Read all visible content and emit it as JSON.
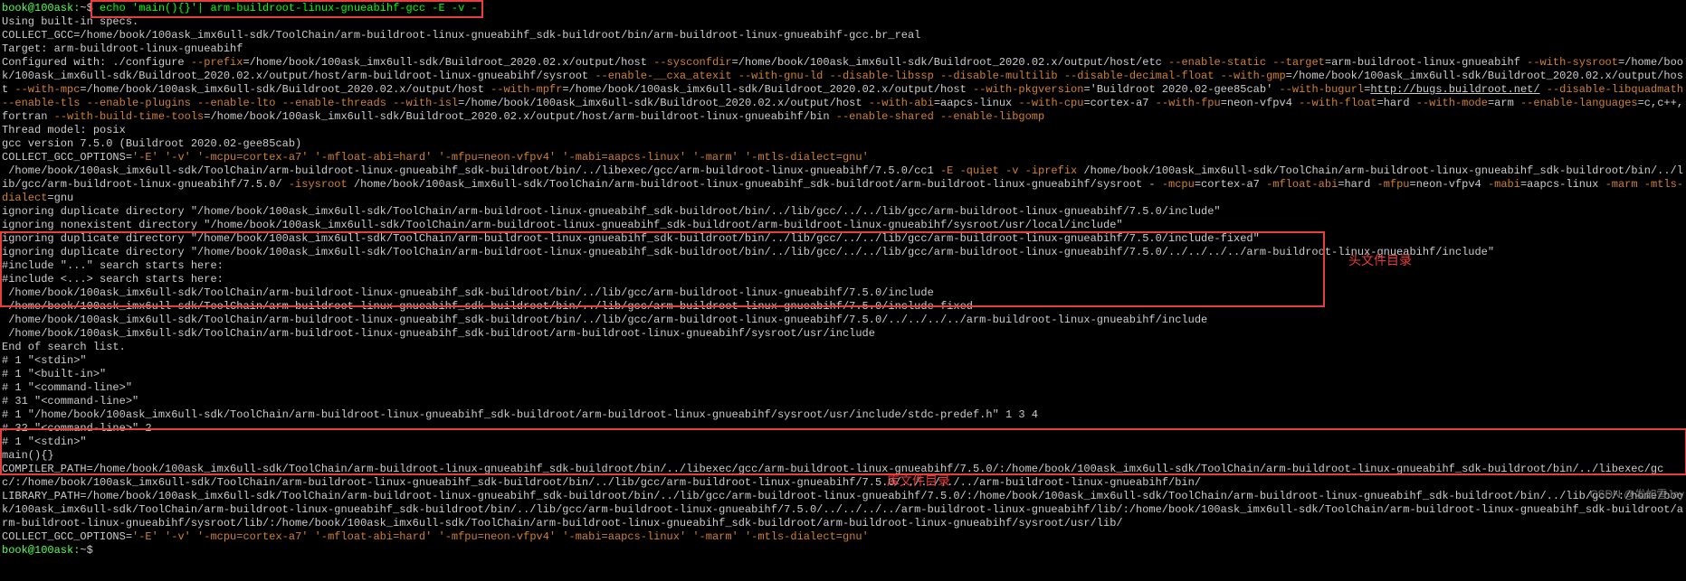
{
  "prompt1_user": "book@100ask:",
  "prompt1_path": "~$ ",
  "command": "echo 'main(){}'| arm-buildroot-linux-gnueabihf-gcc -E -v -",
  "line_using": "Using built-in specs.",
  "collect_gcc_pre": "COLLECT_GCC=",
  "collect_gcc_val": "/home/book/100ask_imx6ull-sdk/ToolChain/arm-buildroot-linux-gnueabihf_sdk-buildroot/bin/arm-buildroot-linux-gnueabihf-gcc.br_real",
  "target_pre": "Target: ",
  "target_val": "arm-buildroot-linux-gnueabihf",
  "cfg_pre": "Configured with: ./configure ",
  "cfg_prefix_k": "--prefix",
  "cfg_prefix_v": "=/home/book/100ask_imx6ull-sdk/Buildroot_2020.02.x/output/host ",
  "cfg_sysconf_k": "--sysconfdir",
  "cfg_sysconf_v": "=/home/book/100ask_imx6ull-sdk/Buildroot_2020.02.x/output/host/etc ",
  "cfg_enstatic": "--enable-static ",
  "cfg_target_k": "--target",
  "cfg_target_v": "=arm-buildroot-linux-gnueabihf ",
  "cfg_sysroot_k": "--with-sysroot",
  "cfg_sysroot_v": "=/home/book/100ask_imx6ull-sdk/Buildroot_2020.02.x/output/host/arm-buildroot-linux-gnueabihf/sysroot ",
  "cfg_cxa": "--enable-__cxa_atexit ",
  "cfg_gnuld": "--with-gnu-ld ",
  "cfg_libssp": "--disable-libssp ",
  "cfg_multi": "--disable-multilib ",
  "cfg_decfloat": "--disable-decimal-float ",
  "cfg_gmp_k": "--with-gmp",
  "cfg_gmp_v": "=/home/book/100ask_imx6ull-sdk/Buildroot_2020.02.x/output/host ",
  "cfg_mpc_k": "--with-mpc",
  "cfg_mpc_v": "=/home/book/100ask_imx6ull-sdk/Buildroot_2020.02.x/output/host ",
  "cfg_mpfr_k": "--with-mpfr",
  "cfg_mpfr_v": "=/home/book/100ask_imx6ull-sdk/Buildroot_2020.02.x/output/host ",
  "cfg_pkgver_k": "--with-pkgversion",
  "cfg_pkgver_v": "='Buildroot 2020.02-gee85cab' ",
  "cfg_bugurl_k": "--with-bugurl",
  "cfg_bugurl_eq": "=",
  "cfg_bugurl_v": "http://bugs.buildroot.net/",
  "cfg_libquad": " --disable-libquadmath ",
  "cfg_tls": "--enable-tls ",
  "cfg_plugins": "--enable-plugins ",
  "cfg_lto": "--enable-lto ",
  "cfg_threads": "--enable-threads ",
  "cfg_isl_k": "--with-isl",
  "cfg_isl_v": "=/home/book/100ask_imx6ull-sdk/Buildroot_2020.02.x/output/host ",
  "cfg_abi_k": "--with-abi",
  "cfg_abi_v": "=aapcs-linux ",
  "cfg_cpu_k": "--with-cpu",
  "cfg_cpu_v": "=cortex-a7 ",
  "cfg_fpu_k": "--with-fpu",
  "cfg_fpu_v": "=neon-vfpv4 ",
  "cfg_float_k": "--with-float",
  "cfg_float_v": "=hard ",
  "cfg_mode_k": "--with-mode",
  "cfg_mode_v": "=arm ",
  "cfg_lang_k": "--enable-languages",
  "cfg_lang_v": "=c,c++,fortran ",
  "cfg_btt_k": "--with-build-time-tools",
  "cfg_btt_v": "=/home/book/100ask_imx6ull-sdk/Buildroot_2020.02.x/output/host/arm-buildroot-linux-gnueabihf/bin ",
  "cfg_shared": "--enable-shared ",
  "cfg_gomp": "--enable-libgomp",
  "thread_model": "Thread model: posix",
  "gcc_version": "gcc version 7.5.0 (Buildroot 2020.02-gee85cab)",
  "opts1_pre": "COLLECT_GCC_OPTIONS=",
  "opts1_val": "'-E' '-v' '-mcpu=cortex-a7' '-mfloat-abi=hard' '-mfpu=neon-vfpv4' '-mabi=aapcs-linux' '-marm' '-mtls-dialect=gnu'",
  "cc1_1": " /home/book/100ask_imx6ull-sdk/ToolChain/arm-buildroot-linux-gnueabihf_sdk-buildroot/bin/../libexec/gcc/arm-buildroot-linux-gnueabihf/7.5.0/cc1 ",
  "cc1_E": "-E ",
  "cc1_q": "-quiet ",
  "cc1_v": "-v ",
  "cc1_ip": "-iprefix",
  "cc1_ip_v": " /home/book/100ask_imx6ull-sdk/ToolChain/arm-buildroot-linux-gnueabihf_sdk-buildroot/bin/../lib/gcc/arm-buildroot-linux-gnueabihf/7.5.0/ ",
  "cc1_isys": "-isysroot",
  "cc1_isys_v": " /home/book/100ask_imx6ull-sdk/ToolChain/arm-buildroot-linux-gnueabihf_sdk-buildroot/arm-buildroot-linux-gnueabihf/sysroot - ",
  "cc1_mcpu": "-mcpu",
  "cc1_mcpu_v": "=cortex-a7 ",
  "cc1_mfabi": "-mfloat-abi",
  "cc1_mfabi_v": "=hard ",
  "cc1_mfpu": "-mfpu",
  "cc1_mfpu_v": "=neon-vfpv4 ",
  "cc1_mabi": "-mabi",
  "cc1_mabi_v": "=aapcs-linux ",
  "cc1_marm": "-marm ",
  "cc1_mtls": "-mtls-dialect",
  "cc1_mtls_v": "=gnu",
  "ign1": "ignoring duplicate directory \"/home/book/100ask_imx6ull-sdk/ToolChain/arm-buildroot-linux-gnueabihf_sdk-buildroot/bin/../lib/gcc/../../lib/gcc/arm-buildroot-linux-gnueabihf/7.5.0/include\"",
  "ign2": "ignoring nonexistent directory \"/home/book/100ask_imx6ull-sdk/ToolChain/arm-buildroot-linux-gnueabihf_sdk-buildroot/arm-buildroot-linux-gnueabihf/sysroot/usr/local/include\"",
  "ign3": "ignoring duplicate directory \"/home/book/100ask_imx6ull-sdk/ToolChain/arm-buildroot-linux-gnueabihf_sdk-buildroot/bin/../lib/gcc/../../lib/gcc/arm-buildroot-linux-gnueabihf/7.5.0/include-fixed\"",
  "ign4": "ignoring duplicate directory \"/home/book/100ask_imx6ull-sdk/ToolChain/arm-buildroot-linux-gnueabihf_sdk-buildroot/bin/../lib/gcc/../../lib/gcc/arm-buildroot-linux-gnueabihf/7.5.0/../../../../arm-buildroot-linux-gnueabihf/include\"",
  "search1": "#include \"...\" search starts here:",
  "search2": "#include <...> search starts here:",
  "inc1": " /home/book/100ask_imx6ull-sdk/ToolChain/arm-buildroot-linux-gnueabihf_sdk-buildroot/bin/../lib/gcc/arm-buildroot-linux-gnueabihf/7.5.0/include",
  "inc2": " /home/book/100ask_imx6ull-sdk/ToolChain/arm-buildroot-linux-gnueabihf_sdk-buildroot/bin/../lib/gcc/arm-buildroot-linux-gnueabihf/7.5.0/include-fixed",
  "inc3": " /home/book/100ask_imx6ull-sdk/ToolChain/arm-buildroot-linux-gnueabihf_sdk-buildroot/bin/../lib/gcc/arm-buildroot-linux-gnueabihf/7.5.0/../../../../arm-buildroot-linux-gnueabihf/include",
  "inc4": " /home/book/100ask_imx6ull-sdk/ToolChain/arm-buildroot-linux-gnueabihf_sdk-buildroot/arm-buildroot-linux-gnueabihf/sysroot/usr/include",
  "end_search": "End of search list.",
  "p1": "# 1 \"<stdin>\"",
  "p2": "# 1 \"<built-in>\"",
  "p3": "# 1 \"<command-line>\"",
  "p4": "# 31 \"<command-line>\"",
  "p5": "# 1 \"/home/book/100ask_imx6ull-sdk/ToolChain/arm-buildroot-linux-gnueabihf_sdk-buildroot/arm-buildroot-linux-gnueabihf/sysroot/usr/include/stdc-predef.h\" 1 3 4",
  "p6": "# 32 \"<command-line>\" 2",
  "p7": "# 1 \"<stdin>\"",
  "mainline": "main(){}",
  "comp_path": "COMPILER_PATH=/home/book/100ask_imx6ull-sdk/ToolChain/arm-buildroot-linux-gnueabihf_sdk-buildroot/bin/../libexec/gcc/arm-buildroot-linux-gnueabihf/7.5.0/:/home/book/100ask_imx6ull-sdk/ToolChain/arm-buildroot-linux-gnueabihf_sdk-buildroot/bin/../libexec/gcc/:/home/book/100ask_imx6ull-sdk/ToolChain/arm-buildroot-linux-gnueabihf_sdk-buildroot/bin/../lib/gcc/arm-buildroot-linux-gnueabihf/7.5.0/../../../../arm-buildroot-linux-gnueabihf/bin/",
  "lib_path": "LIBRARY_PATH=/home/book/100ask_imx6ull-sdk/ToolChain/arm-buildroot-linux-gnueabihf_sdk-buildroot/bin/../lib/gcc/arm-buildroot-linux-gnueabihf/7.5.0/:/home/book/100ask_imx6ull-sdk/ToolChain/arm-buildroot-linux-gnueabihf_sdk-buildroot/bin/../lib/gcc/:/home/book/100ask_imx6ull-sdk/ToolChain/arm-buildroot-linux-gnueabihf_sdk-buildroot/bin/../lib/gcc/arm-buildroot-linux-gnueabihf/7.5.0/../../../../arm-buildroot-linux-gnueabihf/lib/:/home/book/100ask_imx6ull-sdk/ToolChain/arm-buildroot-linux-gnueabihf_sdk-buildroot/arm-buildroot-linux-gnueabihf/sysroot/lib/:/home/book/100ask_imx6ull-sdk/ToolChain/arm-buildroot-linux-gnueabihf_sdk-buildroot/arm-buildroot-linux-gnueabihf/sysroot/usr/lib/",
  "opts2_pre": "COLLECT_GCC_OPTIONS=",
  "opts2_a": "'-E' '-v' ",
  "opts2_mcpu": "'-mcpu=cortex-a7' ",
  "opts2_mfabi": "'-mfloat-abi=hard' ",
  "opts2_mfpu": "'-mfpu=neon-vfpv4' ",
  "opts2_mabi": "'-mabi=aapcs-linux' ",
  "opts2_marm": "'-marm' ",
  "opts2_mtls": "'-mtls-dialect=gnu'",
  "prompt2_user": "book@100ask:",
  "prompt2_path": "~$ ",
  "annot_header": "头文件目录",
  "annot_lib": "库文件目录",
  "watermark": "CSDN @发如雪Jay"
}
